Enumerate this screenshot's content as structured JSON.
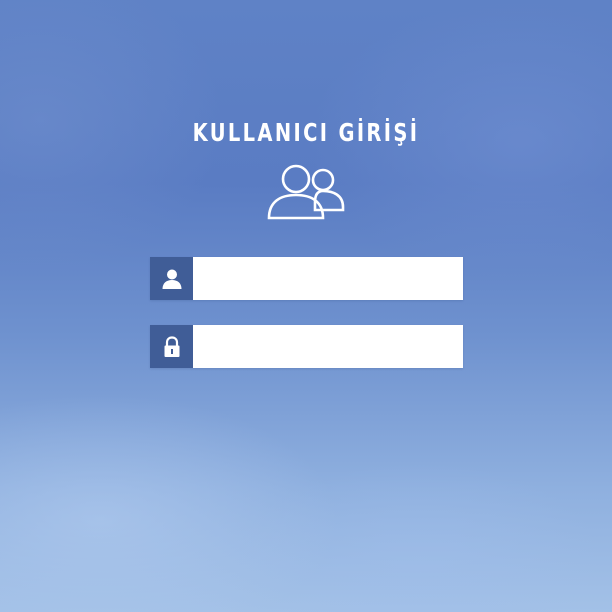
{
  "login": {
    "title": "KULLANICI GİRİŞİ",
    "title_icon": "users-icon",
    "username_field": {
      "icon": "user-icon",
      "value": "",
      "placeholder": ""
    },
    "password_field": {
      "icon": "lock-icon",
      "value": "",
      "placeholder": ""
    }
  },
  "colors": {
    "background_top": "#5a7cc3",
    "background_bottom": "#a3c1e7",
    "icon_box": "#405d97",
    "field_bg": "#ffffff",
    "text": "#ffffff"
  }
}
